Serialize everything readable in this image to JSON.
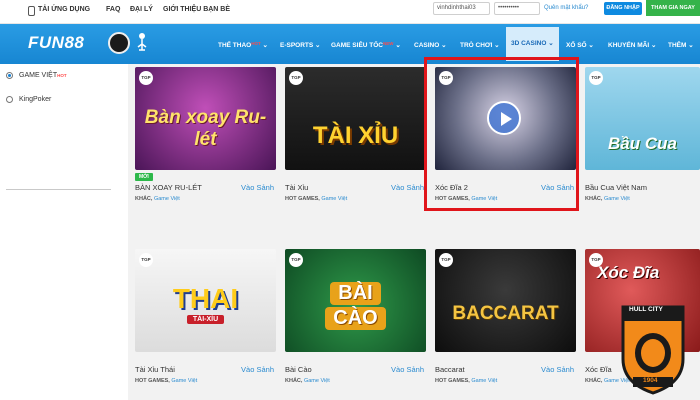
{
  "topbar": {
    "download": "TẢI ỨNG DỤNG",
    "faq": "FAQ",
    "agent": "ĐẠI LÝ",
    "referral": "GIỚI THIỆU BẠN BÈ",
    "username_value": "vinhdinhthai03",
    "password_value": "••••••••••",
    "forgot": "Quên mật khẩu?",
    "login": "ĐĂNG NHẬP",
    "register": "THAM GIA NGAY"
  },
  "brand": {
    "logo": "FUN88"
  },
  "nav": [
    {
      "label": "THỂ THAO",
      "hot": "HOT"
    },
    {
      "label": "E-SPORTS"
    },
    {
      "label": "GAME SIÊU TỐC",
      "hot": "NEW"
    },
    {
      "label": "CASINO"
    },
    {
      "label": "TRÒ CHƠI"
    },
    {
      "label": "3D CASINO"
    },
    {
      "label": "XỔ SỐ"
    },
    {
      "label": "KHUYẾN MÃI"
    },
    {
      "label": "THÊM"
    }
  ],
  "sidebar": {
    "items": [
      {
        "label": "GAME VIỆT",
        "hot": "HOT",
        "selected": true
      },
      {
        "label": "KingPoker",
        "selected": false
      }
    ]
  },
  "open_label": "Vào Sảnh",
  "games": [
    {
      "name": "BÀN XOAY RU-LÉT",
      "category": "KHÁC,",
      "sub": "Game Việt",
      "art": "Bàn xoay Ru-lét",
      "tag": "MỚI"
    },
    {
      "name": "Tài Xỉu",
      "category": "HOT GAMES,",
      "sub": "Game Việt",
      "art": "TÀI XỈU"
    },
    {
      "name": "Xóc Đĩa 2",
      "category": "HOT GAMES,",
      "sub": "Game Việt",
      "art": ""
    },
    {
      "name": "Bầu Cua Việt Nam",
      "category": "KHÁC,",
      "sub": "Game Việt",
      "art": "Bầu Cua"
    },
    {
      "name": "Tài Xỉu Thái",
      "category": "HOT GAMES,",
      "sub": "Game Việt",
      "art": "THAI",
      "art2": "TÀI-XỈU"
    },
    {
      "name": "Bài Cào",
      "category": "KHÁC,",
      "sub": "Game Việt",
      "art": "BÀI",
      "art2": "CÀO"
    },
    {
      "name": "Baccarat",
      "category": "HOT GAMES,",
      "sub": "Game Việt",
      "art": "BACCARAT"
    },
    {
      "name": "Xóc Đĩa",
      "category": "KHÁC,",
      "sub": "Game Việt",
      "art": "Xóc Đĩa"
    }
  ],
  "tgp": "TGP",
  "hull": {
    "top": "HULL CITY",
    "year": "1904"
  },
  "colors": {
    "nav_blue": "#1786d2",
    "highlight_red": "#e0151b",
    "link_blue": "#2a8bd0",
    "new_green": "#2db84a",
    "register_green": "#35b34a"
  }
}
